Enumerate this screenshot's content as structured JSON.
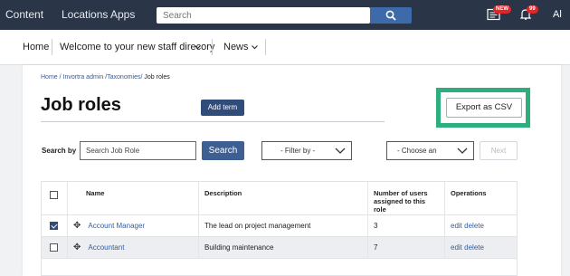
{
  "topbar": {
    "links": [
      "Content",
      "Locations",
      "Apps"
    ],
    "search_placeholder": "Search",
    "news_badge": "NEW",
    "bell_badge": "99",
    "user_initials": "Al"
  },
  "subbar": {
    "home": "Home",
    "welcome": "Welcome to your new staff direcory",
    "news": "News"
  },
  "breadcrumb": {
    "trail": "Home / Invortra admin /Taxonomies/",
    "current": " Job roles"
  },
  "page": {
    "title": "Job roles",
    "add_term": "Add term",
    "export": "Export as CSV"
  },
  "filters": {
    "search_by_label": "Search by",
    "search_placeholder": "Search Job Role",
    "search_button": "Search",
    "filter_by": "- Filter by -",
    "choose": "- Choose an",
    "next": "Next"
  },
  "table": {
    "headers": {
      "name": "Name",
      "description": "Description",
      "users": "Number of users assigned to this role",
      "operations": "Operations"
    },
    "rows": [
      {
        "name": "Account Manager",
        "description": "The lead on project management",
        "users": "3",
        "edit": "edit",
        "delete": "delete",
        "checked": true
      },
      {
        "name": "Accountant",
        "description": "Building maintenance",
        "users": "7",
        "edit": "edit",
        "delete": "delete",
        "checked": false
      }
    ]
  },
  "colors": {
    "topbar": "#2b3548",
    "accent": "#3d5f92",
    "highlight": "#2fae7d"
  }
}
